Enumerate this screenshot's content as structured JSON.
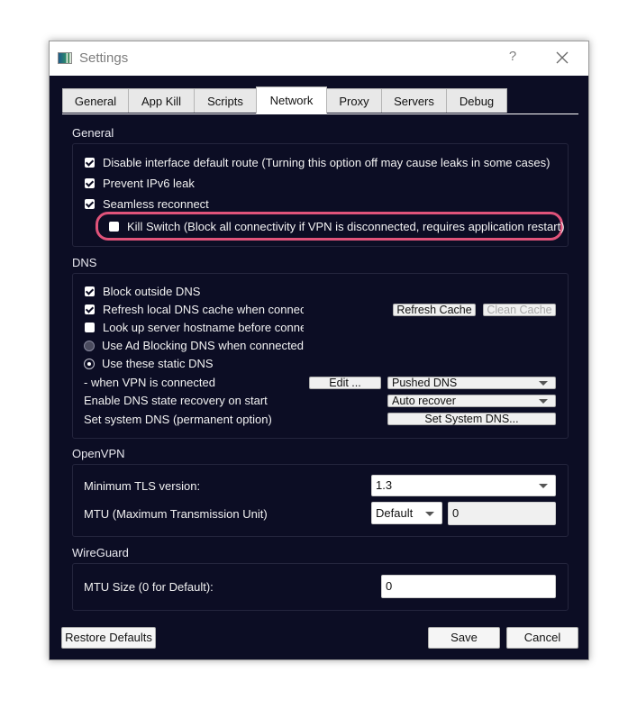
{
  "window": {
    "title": "Settings",
    "help_label": "?",
    "close_icon": "close-icon",
    "app_icon": "app-window-icon"
  },
  "tabs": [
    {
      "label": "General",
      "active": false
    },
    {
      "label": "App Kill",
      "active": false
    },
    {
      "label": "Scripts",
      "active": false
    },
    {
      "label": "Network",
      "active": true
    },
    {
      "label": "Proxy",
      "active": false
    },
    {
      "label": "Servers",
      "active": false
    },
    {
      "label": "Debug",
      "active": false
    }
  ],
  "general": {
    "title": "General",
    "options": [
      {
        "label": "Disable interface default route (Turning this option off may cause leaks in some cases)",
        "checked": true
      },
      {
        "label": "Prevent IPv6 leak",
        "checked": true
      },
      {
        "label": "Seamless reconnect",
        "checked": true
      },
      {
        "label": "Kill Switch (Block all connectivity if VPN is disconnected, requires application restart)",
        "checked": false,
        "highlighted": true,
        "highlight_color": "#e0537a"
      }
    ]
  },
  "dns": {
    "title": "DNS",
    "options": [
      {
        "label": "Block outside DNS",
        "type": "checkbox",
        "checked": true
      },
      {
        "label": "Refresh local DNS cache when connected",
        "type": "checkbox",
        "checked": true
      },
      {
        "label": "Look up server hostname before connecting",
        "type": "checkbox",
        "checked": false
      },
      {
        "label": "Use Ad Blocking DNS when connected",
        "type": "radio",
        "checked": false
      },
      {
        "label": "Use these static DNS",
        "type": "radio",
        "checked": true
      }
    ],
    "refresh_cache_label": "Refresh Cache",
    "clean_cache_label": "Clean Cache",
    "when_connected_label": "- when VPN is connected",
    "edit_label": "Edit ...",
    "dns_mode_value": "Pushed DNS",
    "recovery_label": "Enable DNS state recovery on start",
    "recovery_value": "Auto recover",
    "system_dns_label": "Set system DNS (permanent option)",
    "set_system_dns_button": "Set System DNS..."
  },
  "openvpn": {
    "title": "OpenVPN",
    "tls_label": "Minimum TLS version:",
    "tls_value": "1.3",
    "mtu_label": "MTU (Maximum Transmission Unit)",
    "mtu_mode_value": "Default",
    "mtu_value": "0"
  },
  "wireguard": {
    "title": "WireGuard",
    "mtu_label": "MTU Size (0 for Default):",
    "mtu_value": "0"
  },
  "footer": {
    "restore_label": "Restore Defaults",
    "save_label": "Save",
    "cancel_label": "Cancel"
  },
  "colors": {
    "background": "#0c0d24",
    "highlight": "#e0537a"
  }
}
